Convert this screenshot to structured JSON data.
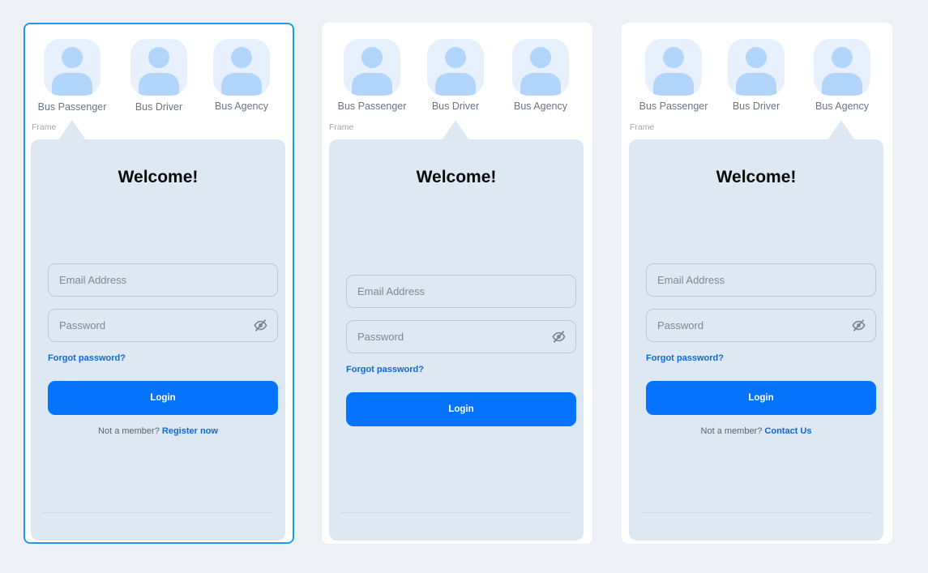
{
  "cards": [
    {
      "roles": [
        "Bus Passenger",
        "Bus Driver",
        "Bus Agency"
      ],
      "frame_label": "Frame",
      "welcome": "Welcome!",
      "email_placeholder": "Email Address",
      "password_placeholder": "Password",
      "forgot": "Forgot password?",
      "login": "Login",
      "member_text": "Not a member?",
      "member_link": "Register now",
      "selected": true
    },
    {
      "roles": [
        "Bus Passenger",
        "Bus Driver",
        "Bus Agency"
      ],
      "frame_label": "Frame",
      "welcome": "Welcome!",
      "email_placeholder": "Email Address",
      "password_placeholder": "Password",
      "forgot": "Forgot password?",
      "login": "Login"
    },
    {
      "roles": [
        "Bus Passenger",
        "Bus Driver",
        "Bus Agency"
      ],
      "frame_label": "Frame",
      "welcome": "Welcome!",
      "email_placeholder": "Email Address",
      "password_placeholder": "Password",
      "forgot": "Forgot password?",
      "login": "Login",
      "member_text": "Not a member?",
      "member_link": "Contact Us"
    }
  ],
  "colors": {
    "background": "#edf0f4",
    "panel": "#dde8f2",
    "primary": "#0573fb",
    "link": "#1069d8",
    "selection": "#1a9bf0"
  },
  "icons": {
    "avatar": "user-icon",
    "password_toggle": "eye-off-icon"
  }
}
